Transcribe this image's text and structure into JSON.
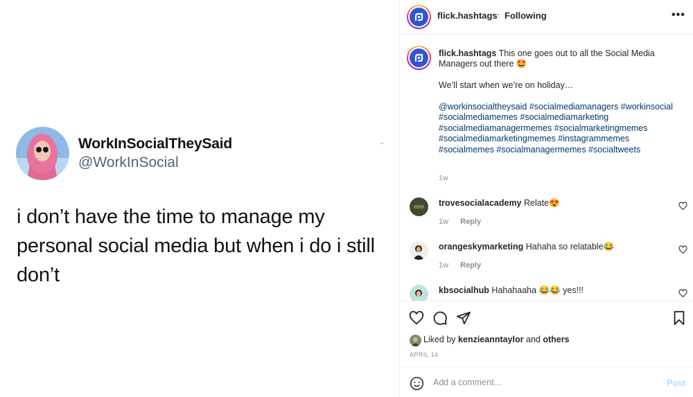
{
  "tweet": {
    "name": "WorkInSocialTheySaid",
    "handle": "@WorkInSocial",
    "text": "i don’t have the time to manage my personal social media but when i do i still don’t"
  },
  "header": {
    "username": "flick.hashtags",
    "separator": "·",
    "follow_status": "Following",
    "more_icon": "more-horizontal-icon"
  },
  "caption": {
    "username": "flick.hashtags",
    "text_line1": "This one goes out to all the Social Media Managers out there 🤩",
    "text_line2": "We’ll start when we’re on holiday…",
    "tags": "@workinsocialtheysaid #socialmediamanagers #workinsocial #socialmediamemes #socialmediamarketing #socialmediamanagermemes #socialmarketingmemes #socialmediamarketingmemes #instagrammemes #socialmemes #socialmanagermemes #socialtweets",
    "time": "1w"
  },
  "comments": [
    {
      "username": "trovesocialacademy",
      "text": "Relate😍",
      "time": "1w",
      "reply": "Reply"
    },
    {
      "username": "orangeskymarketing",
      "text": "Hahaha so relatable😂",
      "time": "1w",
      "reply": "Reply"
    },
    {
      "username": "kbsocialhub",
      "text": "Hahahaaha 😂😂 yes!!!"
    }
  ],
  "likes": {
    "prefix": "Liked by",
    "user": "kenzieanntaylor",
    "and": "and",
    "others": "others"
  },
  "date": "APRIL 14",
  "add_comment": {
    "placeholder": "Add a comment...",
    "post_label": "Post"
  },
  "colors": {
    "link": "#00376b",
    "secondary_text": "#8e8e8e",
    "post_disabled": "#b3dbff",
    "brand_blue": "#2f55d4"
  }
}
